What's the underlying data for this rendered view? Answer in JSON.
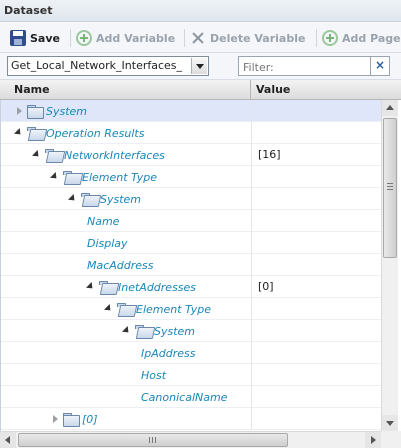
{
  "panel": {
    "title": "Dataset"
  },
  "toolbar": {
    "save": {
      "label": "Save",
      "icon": "save-icon"
    },
    "add_variable": {
      "label": "Add Variable",
      "icon": "add-icon"
    },
    "delete_variable": {
      "label": "Delete Variable",
      "icon": "delete-icon"
    },
    "add_page": {
      "label": "Add Page",
      "icon": "add-icon"
    }
  },
  "filter": {
    "select_value": "Get_Local_Network_Interfaces_",
    "placeholder": "Filter:",
    "clear_label": "×"
  },
  "grid": {
    "columns": {
      "name": "Name",
      "value": "Value"
    },
    "rows": [
      {
        "label": "System",
        "value": "",
        "toggle": "collapsed",
        "folder": true
      },
      {
        "label": "Operation Results",
        "value": "",
        "toggle": "expanded",
        "folder": true
      },
      {
        "label": "NetworkInterfaces",
        "value": "[16]",
        "toggle": "expanded",
        "folder": true
      },
      {
        "label": "Element Type",
        "value": "",
        "toggle": "expanded",
        "folder": true
      },
      {
        "label": "System",
        "value": "",
        "toggle": "expanded",
        "folder": true
      },
      {
        "label": "Name",
        "value": "",
        "toggle": "none",
        "folder": false
      },
      {
        "label": "Display",
        "value": "",
        "toggle": "none",
        "folder": false
      },
      {
        "label": "MacAddress",
        "value": "",
        "toggle": "none",
        "folder": false
      },
      {
        "label": "InetAddresses",
        "value": "[0]",
        "toggle": "expanded",
        "folder": true
      },
      {
        "label": "Element Type",
        "value": "",
        "toggle": "expanded",
        "folder": true
      },
      {
        "label": "System",
        "value": "",
        "toggle": "expanded",
        "folder": true
      },
      {
        "label": "IpAddress",
        "value": "",
        "toggle": "none",
        "folder": false
      },
      {
        "label": "Host",
        "value": "",
        "toggle": "none",
        "folder": false
      },
      {
        "label": "CanonicalName",
        "value": "",
        "toggle": "none",
        "folder": false
      },
      {
        "label": "[0]",
        "value": "",
        "toggle": "collapsed",
        "folder": true
      }
    ]
  },
  "colors": {
    "node_label": "#1a87b8",
    "selected_row": "#dfe6fa"
  }
}
